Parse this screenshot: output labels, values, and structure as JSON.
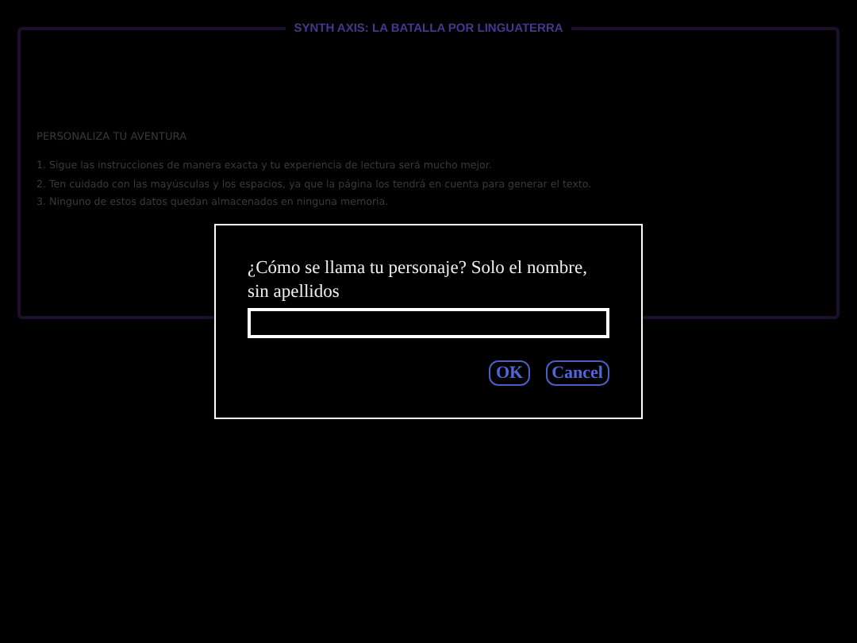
{
  "panel": {
    "title": "SYNTH AXIS: LA BATALLA POR LINGUATERRA",
    "heading": "PERSONALIZA TU AVENTURA",
    "instructions": [
      "1. Sigue las instrucciones de manera exacta y tu experiencia de lectura será mucho mejor.",
      "2. Ten cuidado con las mayúsculas y los espacios, ya que la página los tendrá en cuenta para generar el texto.",
      "3. Ninguno de estos datos quedan almacenados en ninguna memoria."
    ]
  },
  "dialog": {
    "prompt": "¿Cómo se llama tu personaje? Solo el nombre, sin apellidos",
    "buttons": [
      "OK",
      "Cancel"
    ]
  }
}
